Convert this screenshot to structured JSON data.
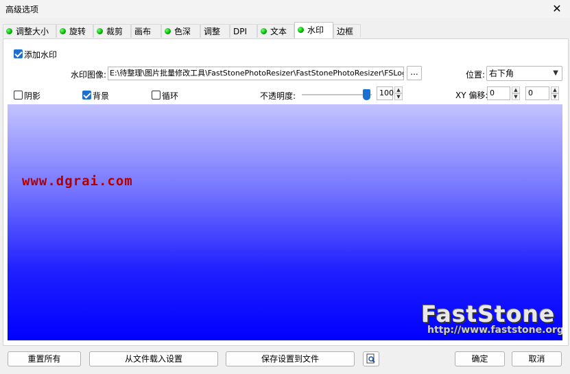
{
  "window": {
    "title": "高级选项",
    "close_label": "✕"
  },
  "tabs": [
    {
      "label": "调整大小",
      "has_dot": true
    },
    {
      "label": "旋转",
      "has_dot": true
    },
    {
      "label": "裁剪",
      "has_dot": true
    },
    {
      "label": "画布",
      "has_dot": false
    },
    {
      "label": "色深",
      "has_dot": true
    },
    {
      "label": "调整",
      "has_dot": false
    },
    {
      "label": "DPI",
      "has_dot": false
    },
    {
      "label": "文本",
      "has_dot": true
    },
    {
      "label": "水印",
      "has_dot": true,
      "active": true
    },
    {
      "label": "边框",
      "has_dot": false
    }
  ],
  "watermark": {
    "add_label": "添加水印",
    "add_checked": true,
    "image_label": "水印图像:",
    "image_path": "E:\\待整理\\图片批量修改工具\\FastStonePhotoResizer\\FastStonePhotoResizer\\FSLogo.p",
    "browse_label": "...",
    "position_label": "位置:",
    "position_value": "右下角",
    "shadow_label": "阴影",
    "shadow_checked": false,
    "background_label": "背景",
    "background_checked": true,
    "loop_label": "循环",
    "loop_checked": false,
    "opacity_label": "不透明度:",
    "opacity_value": "100",
    "xy_label": "XY 偏移:",
    "x_value": "0",
    "y_value": "0"
  },
  "preview": {
    "site_text": "www.dgrai.com",
    "logo_text": "FastStone",
    "logo_url": "http://www.faststone.org",
    "colors": {
      "top": "#c3c3ff",
      "bottom": "#0000ff",
      "site_text": "#b10000"
    }
  },
  "buttons": {
    "reset_all": "重置所有",
    "load_settings": "从文件载入设置",
    "save_settings": "保存设置到文件",
    "ok": "确定",
    "cancel": "取消"
  }
}
